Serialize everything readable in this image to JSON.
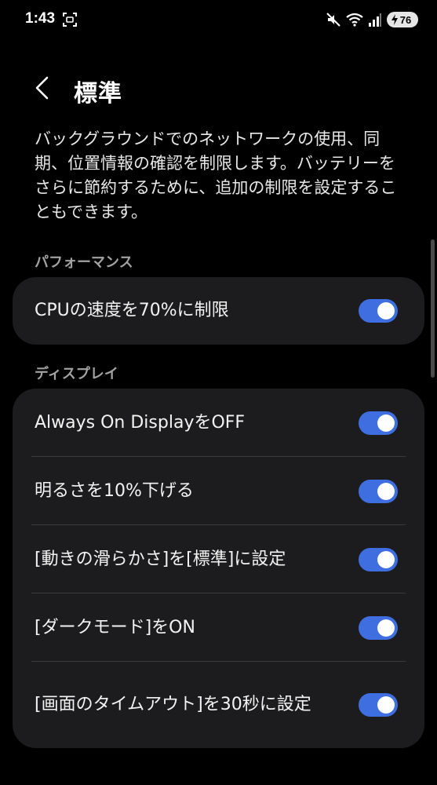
{
  "status_bar": {
    "time": "1:43",
    "battery_level": "76",
    "icons": [
      "screenshot-icon",
      "mute-icon",
      "wifi-icon",
      "signal-icon",
      "battery-icon"
    ]
  },
  "header": {
    "title": "標準",
    "back_icon": "chevron-left-icon"
  },
  "description": "バックグラウンドでのネットワークの使用、同期、位置情報の確認を制限します。バッテリーをさらに節約するために、追加の制限を設定することもできます。",
  "sections": [
    {
      "label": "パフォーマンス",
      "items": [
        {
          "label": "CPUの速度を70%に制限",
          "enabled": true
        }
      ]
    },
    {
      "label": "ディスプレイ",
      "items": [
        {
          "label": "Always On DisplayをOFF",
          "enabled": true
        },
        {
          "label": "明るさを10%下げる",
          "enabled": true
        },
        {
          "label": "[動きの滑らかさ]を[標準]に設定",
          "enabled": true
        },
        {
          "label": "[ダークモード]をON",
          "enabled": true
        },
        {
          "label": "[画面のタイムアウト]を30秒に設定",
          "enabled": true
        }
      ]
    }
  ],
  "colors": {
    "background": "#000000",
    "card": "#1c1c1e",
    "toggle_on": "#3e6ee0",
    "section_label": "#a3a3a3"
  }
}
